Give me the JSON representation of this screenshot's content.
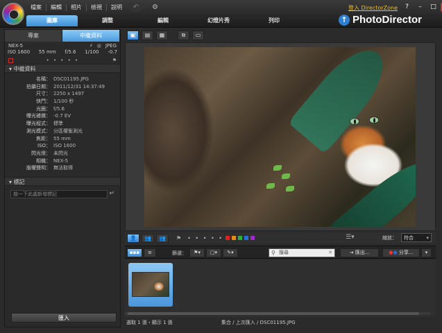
{
  "menu": [
    "檔案",
    "編輯",
    "相片",
    "檢視",
    "說明"
  ],
  "mode_tabs": [
    {
      "label": "圖庫",
      "active": true,
      "width": 74
    },
    {
      "label": "調整",
      "active": false,
      "width": 74
    },
    {
      "label": "編輯",
      "active": false,
      "width": 74
    },
    {
      "label": "幻燈片秀",
      "active": false,
      "width": 74
    },
    {
      "label": "列印",
      "active": false,
      "width": 74
    }
  ],
  "signin": "登入 DirectorZone",
  "window_controls": [
    "?",
    "–",
    "□",
    "✕"
  ],
  "brand": "PhotoDirector",
  "left_panel": {
    "tabs": [
      "專案",
      "中繼資料"
    ],
    "camera": "NEX-5",
    "format": "JPEG",
    "exif_summary": [
      "ISO 1600",
      "55 mm",
      "f/5.6",
      "1/100",
      "-0.7"
    ],
    "rating_dots": "• • • • •",
    "metadata_section": "中繼資料",
    "metadata": [
      {
        "key": "名稱",
        "value": "DSC01195.JPG"
      },
      {
        "key": "拍攝日期",
        "value": "2011/12/31 14:37:49"
      },
      {
        "key": "尺寸",
        "value": "2250 x 1497"
      },
      {
        "key": "快門",
        "value": "1/100 秒"
      },
      {
        "key": "光圈",
        "value": "f/5.6"
      },
      {
        "key": "曝光補償",
        "value": "-0.7 EV"
      },
      {
        "key": "曝光程式",
        "value": "標準"
      },
      {
        "key": "測光模式",
        "value": "分區權衡測光"
      },
      {
        "key": "焦距",
        "value": "55 mm"
      },
      {
        "key": "ISO",
        "value": "ISO 1600"
      },
      {
        "key": "閃光燈",
        "value": "未閃光"
      },
      {
        "key": "相機",
        "value": "NEX-5"
      },
      {
        "key": "版權聲明",
        "value": "無法取得"
      }
    ],
    "tags_section": "標記",
    "tag_placeholder": "按一下此處新增標記",
    "import_label": "匯入"
  },
  "toolbar": [
    "▣",
    "▤",
    "▦",
    "⧉",
    "▭"
  ],
  "filmstrip_bar": {
    "people_buttons": [
      "👤",
      "👥",
      "👥"
    ],
    "rating_dots": "• • • • •",
    "color_labels": [
      "#e02020",
      "#e88a1a",
      "#2bb13a",
      "#2a6fe0",
      "#a02ad0"
    ],
    "zoom_label": "縮放：",
    "zoom_value": "符合"
  },
  "filter_bar": {
    "filter_label": "篩選：",
    "search_placeholder": "搜尋",
    "export_label": "匯出...",
    "share_label": "分享..."
  },
  "status": {
    "selection": "選取 1 張・顯示 1 張",
    "path": "集合 / 上次匯入 / DSC01195.JPG"
  }
}
